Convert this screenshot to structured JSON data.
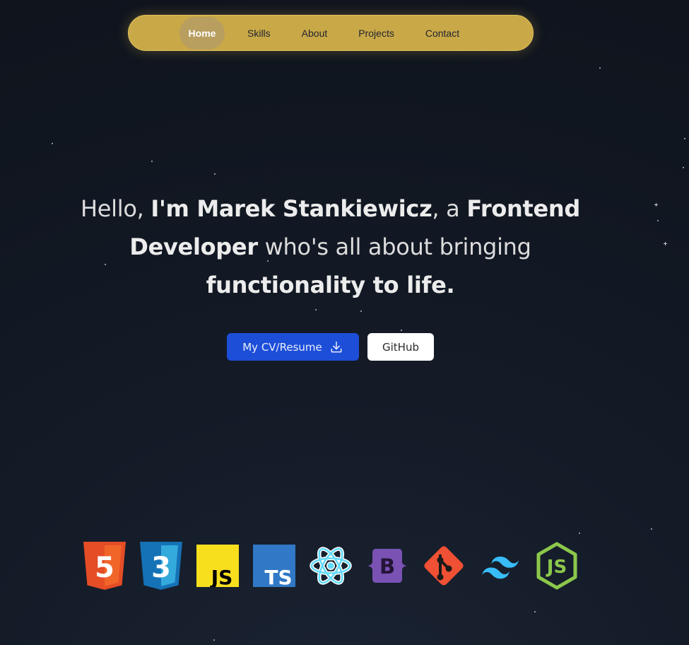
{
  "nav": {
    "items": [
      {
        "label": "Home",
        "active": true
      },
      {
        "label": "Skills",
        "active": false
      },
      {
        "label": "About",
        "active": false
      },
      {
        "label": "Projects",
        "active": false
      },
      {
        "label": "Contact",
        "active": false
      }
    ],
    "background": "#c9a847"
  },
  "hero": {
    "p1": "Hello, ",
    "name": "I'm Marek Stankiewicz",
    "p2": ", a ",
    "role": "Frontend Developer",
    "p3": " who's all about bringing ",
    "tagline": "functionality to life."
  },
  "buttons": {
    "cv_label": "My CV/Resume",
    "github_label": "GitHub",
    "cv_color": "#1d4ed8"
  },
  "tech_stack": {
    "html_text": "5",
    "css_text": "3",
    "js_text": "JS",
    "ts_text": "TS",
    "bootstrap_text": "B",
    "node_text": "JS",
    "icons": [
      "html5-icon",
      "css3-icon",
      "javascript-icon",
      "typescript-icon",
      "react-icon",
      "bootstrap-icon",
      "git-icon",
      "tailwind-icon",
      "nodejs-icon"
    ]
  }
}
